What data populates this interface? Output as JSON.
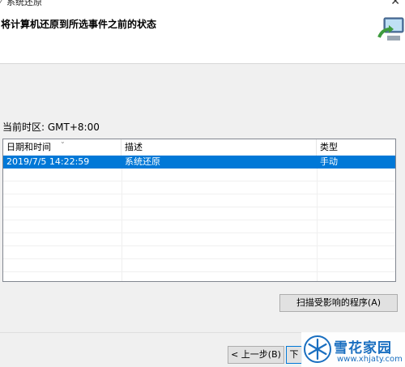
{
  "window": {
    "title": "系统还原",
    "heading": "将计算机还原到所选事件之前的状态"
  },
  "timezone": {
    "label": "当前时区: GMT+8:00"
  },
  "table": {
    "columns": [
      "日期和时间",
      "描述",
      "类型"
    ],
    "rows": [
      {
        "datetime": "2019/7/5 14:22:59",
        "description": "系统还原",
        "type": "手动",
        "selected": true
      }
    ]
  },
  "buttons": {
    "scan": "扫描受影响的程序(A)",
    "back": "< 上一步(B)",
    "next": "下"
  },
  "watermark": {
    "name": "雪花家园",
    "url": "www.xhjaty.com"
  },
  "colors": {
    "selection": "#0078d7",
    "watermark": "#1a6fc0"
  },
  "icons": {
    "app": "system-restore-icon",
    "logo": "system-restore-logo",
    "close": "close-icon",
    "sort": "sort-arrow-icon",
    "watermark": "snowflake-logo"
  }
}
